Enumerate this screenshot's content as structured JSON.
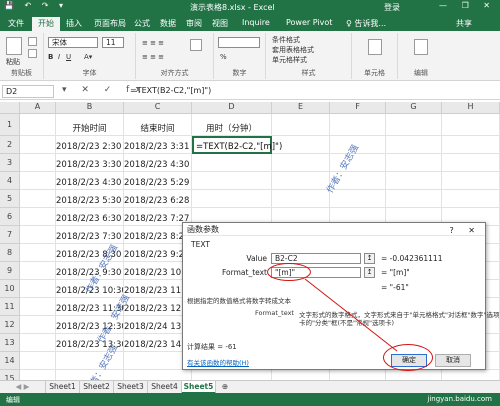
{
  "window": {
    "title": "演示表格8.xlsx - Excel",
    "login": "登录",
    "controls": "— ❐ ✕"
  },
  "qat": "💾 ↶ ↷ ▾",
  "tabs": [
    "文件",
    "开始",
    "插入",
    "页面布局",
    "公式",
    "数据",
    "审阅",
    "视图",
    "Inquire",
    "Power Pivot",
    "♀ 告诉我...",
    "共享"
  ],
  "ribbon": {
    "clipboard": "剪贴板",
    "paste": "粘贴",
    "font": "字体",
    "font_name": "宋体",
    "font_size": "11",
    "alignment": "对齐方式",
    "number": "数字",
    "number_format": "%",
    "styles": "样式",
    "cond_format": "条件格式",
    "table_format": "套用表格格式",
    "cell_styles": "单元格样式",
    "cells": "单元格",
    "editing": "编辑"
  },
  "formula_bar": {
    "name_box": "D2",
    "buttons": "▾ ✕ ✓ fx",
    "formula": "=TEXT(B2-C2,\"[m]\")"
  },
  "columns": [
    "A",
    "B",
    "C",
    "D",
    "E",
    "F",
    "G",
    "H"
  ],
  "rows": [
    "1",
    "2",
    "3",
    "4",
    "5",
    "6",
    "7",
    "8",
    "9",
    "10",
    "11",
    "12",
    "13",
    "14",
    "15"
  ],
  "headers": {
    "b": "开始时间",
    "c": "结束时间",
    "d": "用时（分钟）"
  },
  "active_cell_text": "=TEXT(B2-C2,\"[m]\")",
  "start_times": [
    "2018/2/23 2:30",
    "2018/2/23 3:30",
    "2018/2/23 4:30",
    "2018/2/23 5:30",
    "2018/2/23 6:30",
    "2018/2/23 7:30",
    "2018/2/23 8:30",
    "2018/2/23 9:30",
    "2018/2/23 10:30",
    "2018/2/23 11:30",
    "2018/2/23 12:30",
    "2018/2/23 13:30"
  ],
  "end_times": [
    "2018/2/23 3:31",
    "2018/2/23 4:30",
    "2018/2/23 5:29",
    "2018/2/23 6:28",
    "2018/2/23 7:27",
    "2018/2/23 8:26",
    "2018/2/23 9:25",
    "2018/2/23 10:2",
    "2018/2/23 11:2",
    "2018/2/23 12:2",
    "2018/2/24 13:2",
    "2018/2/23 14:2"
  ],
  "watermark": "作者：安志强",
  "dialog": {
    "title": "函数参数",
    "controls": "? ✕",
    "function_name": "TEXT",
    "value_label": "Value",
    "value_input": "B2-C2",
    "value_result": "= -0.042361111",
    "format_label": "Format_text",
    "format_input": "\"[m]\"",
    "format_result": "= \"[m]\"",
    "overall_result": "= \"-61\"",
    "description": "根据指定的数值格式将数字转成文本",
    "arg_name": "Format_text",
    "arg_desc_1": "文字形式的数字格式，文字形式来自于\"单元格格式\"对话框\"数字\"选项",
    "arg_desc_2": "卡的\"分类\"框(不是\"常规\"选项卡)",
    "calc_result": "计算结果 =   -61",
    "help_link": "有关该函数的帮助(H)",
    "ok": "确定",
    "cancel": "取消"
  },
  "sheets": [
    "Sheet1",
    "Sheet2",
    "Sheet3",
    "Sheet4",
    "Sheet5"
  ],
  "active_sheet": "Sheet5",
  "add_sheet": "⊕",
  "status": {
    "left": "编辑",
    "right": "jingyan.baidu.com"
  }
}
